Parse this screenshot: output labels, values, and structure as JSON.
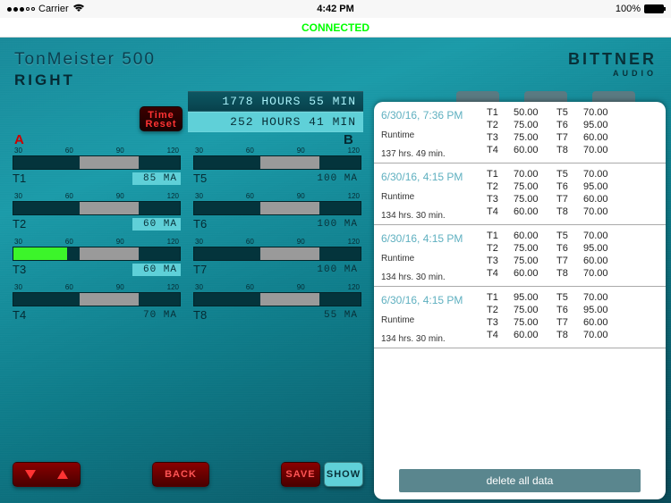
{
  "status": {
    "carrier": "Carrier",
    "time": "4:42 PM",
    "battery": "100%"
  },
  "connection": "CONNECTED",
  "title": {
    "line1": "TonMeister 500",
    "line2": "RIGHT"
  },
  "brand": {
    "line1": "BITTNER",
    "line2": "AUDIO"
  },
  "hours": {
    "total": "1778 HOURS 55 MIN",
    "session": "252 HOURS 41 MIN"
  },
  "time_reset_label": "Time Reset",
  "columns": {
    "a": "A",
    "b": "B"
  },
  "scale": [
    "30",
    "60",
    "90",
    "120"
  ],
  "gauges_a": [
    {
      "name": "T1",
      "value": "85 MA",
      "hl": true,
      "fill": 40,
      "lime": false
    },
    {
      "name": "T2",
      "value": "60 MA",
      "hl": true,
      "fill": 18,
      "lime": false
    },
    {
      "name": "T3",
      "value": "60 MA",
      "hl": true,
      "fill": 32,
      "lime": true
    },
    {
      "name": "T4",
      "value": "70 MA",
      "hl": false,
      "fill": 40,
      "lime": false
    }
  ],
  "gauges_b": [
    {
      "name": "T5",
      "value": "100 MA",
      "hl": false,
      "fill": 40,
      "lime": false
    },
    {
      "name": "T6",
      "value": "100 MA",
      "hl": false,
      "fill": 40,
      "lime": false
    },
    {
      "name": "T7",
      "value": "100 MA",
      "hl": false,
      "fill": 40,
      "lime": false
    },
    {
      "name": "T8",
      "value": "55 MA",
      "hl": false,
      "fill": 40,
      "lime": false
    }
  ],
  "buttons": {
    "back": "BACK",
    "save": "SAVE",
    "show": "SHOW"
  },
  "log": {
    "delete_label": "delete all data",
    "entries": [
      {
        "date": "6/30/16,  7:36 PM",
        "runtime_label": "Runtime",
        "runtime": "137 hrs. 49 min.",
        "t": [
          "50.00",
          "75.00",
          "75.00",
          "60.00",
          "70.00",
          "95.00",
          "60.00",
          "70.00"
        ]
      },
      {
        "date": "6/30/16,  4:15 PM",
        "runtime_label": "Runtime",
        "runtime": "134 hrs. 30 min.",
        "t": [
          "70.00",
          "75.00",
          "75.00",
          "60.00",
          "70.00",
          "95.00",
          "60.00",
          "70.00"
        ]
      },
      {
        "date": "6/30/16,  4:15 PM",
        "runtime_label": "Runtime",
        "runtime": "134 hrs. 30 min.",
        "t": [
          "60.00",
          "75.00",
          "75.00",
          "60.00",
          "70.00",
          "95.00",
          "60.00",
          "70.00"
        ]
      },
      {
        "date": "6/30/16,  4:15 PM",
        "runtime_label": "Runtime",
        "runtime": "134 hrs. 30 min.",
        "t": [
          "95.00",
          "75.00",
          "75.00",
          "60.00",
          "70.00",
          "95.00",
          "60.00",
          "70.00"
        ]
      }
    ]
  }
}
